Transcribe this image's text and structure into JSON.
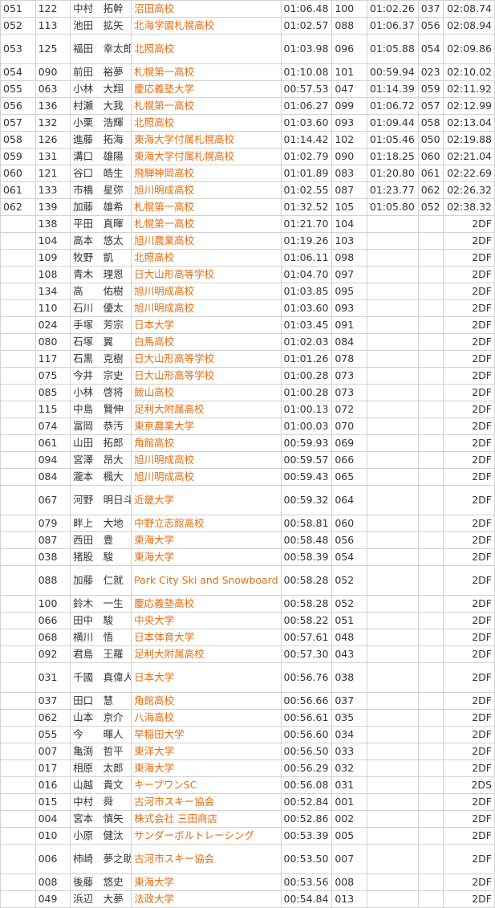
{
  "colors": {
    "team_link": "#e86d10",
    "text": "#333333",
    "border": "#d2d2d2"
  },
  "rows": [
    {
      "rank": "051",
      "bib": "122",
      "name": "中村　拓幹",
      "team": "沼田高校",
      "run1": "01:06.48",
      "rank1": "100",
      "run2": "01:02.26",
      "rank2": "037",
      "total": "02:08.74"
    },
    {
      "rank": "052",
      "bib": "113",
      "name": "池田　拡矢",
      "team": "北海学園札幌高校",
      "run1": "01:02.57",
      "rank1": "088",
      "run2": "01:06.37",
      "rank2": "056",
      "total": "02:08.94"
    },
    {
      "rank": "053",
      "bib": "125",
      "name": "福田　幸太郎",
      "team": "北照高校",
      "run1": "01:03.98",
      "rank1": "096",
      "run2": "01:05.88",
      "rank2": "054",
      "total": "02:09.86",
      "tall": true
    },
    {
      "rank": "054",
      "bib": "090",
      "name": "前田　裕夢",
      "team": "札幌第一高校",
      "run1": "01:10.08",
      "rank1": "101",
      "run2": "00:59.94",
      "rank2": "023",
      "total": "02:10.02"
    },
    {
      "rank": "055",
      "bib": "063",
      "name": "小林　大翔",
      "team": "慶応義塾大学",
      "run1": "00:57.53",
      "rank1": "047",
      "run2": "01:14.39",
      "rank2": "059",
      "total": "02:11.92"
    },
    {
      "rank": "056",
      "bib": "136",
      "name": "村瀬　大我",
      "team": "札幌第一高校",
      "run1": "01:06.27",
      "rank1": "099",
      "run2": "01:06.72",
      "rank2": "057",
      "total": "02:12.99"
    },
    {
      "rank": "057",
      "bib": "132",
      "name": "小栗　浩輝",
      "team": "北照高校",
      "run1": "01:03.60",
      "rank1": "093",
      "run2": "01:09.44",
      "rank2": "058",
      "total": "02:13.04"
    },
    {
      "rank": "058",
      "bib": "126",
      "name": "進藤　拓海",
      "team": "東海大学付属札幌高校",
      "run1": "01:14.42",
      "rank1": "102",
      "run2": "01:05.46",
      "rank2": "050",
      "total": "02:19.88"
    },
    {
      "rank": "059",
      "bib": "131",
      "name": "溝口　雄陽",
      "team": "東海大学付属札幌高校",
      "run1": "01:02.79",
      "rank1": "090",
      "run2": "01:18.25",
      "rank2": "060",
      "total": "02:21.04"
    },
    {
      "rank": "060",
      "bib": "121",
      "name": "谷口　皓生",
      "team": "飛騨神岡高校",
      "run1": "01:01.89",
      "rank1": "083",
      "run2": "01:20.80",
      "rank2": "061",
      "total": "02:22.69"
    },
    {
      "rank": "061",
      "bib": "133",
      "name": "市橋　星弥",
      "team": "旭川明成高校",
      "run1": "01:02.55",
      "rank1": "087",
      "run2": "01:23.77",
      "rank2": "062",
      "total": "02:26.32"
    },
    {
      "rank": "062",
      "bib": "139",
      "name": "加藤　雄希",
      "team": "札幌第一高校",
      "run1": "01:32.52",
      "rank1": "105",
      "run2": "01:05.80",
      "rank2": "052",
      "total": "02:38.32"
    },
    {
      "rank": "",
      "bib": "138",
      "name": "平田　真暉",
      "team": "札幌第一高校",
      "run1": "01:21.70",
      "rank1": "104",
      "run2": "",
      "rank2": "",
      "total": "2DF"
    },
    {
      "rank": "",
      "bib": "104",
      "name": "高本　悠太",
      "team": "旭川農業高校",
      "run1": "01:19.26",
      "rank1": "103",
      "run2": "",
      "rank2": "",
      "total": "2DF"
    },
    {
      "rank": "",
      "bib": "109",
      "name": "牧野　凱",
      "team": "北照高校",
      "run1": "01:06.11",
      "rank1": "098",
      "run2": "",
      "rank2": "",
      "total": "2DF"
    },
    {
      "rank": "",
      "bib": "108",
      "name": "青木　理恩",
      "team": "日大山形高等学校",
      "run1": "01:04.70",
      "rank1": "097",
      "run2": "",
      "rank2": "",
      "total": "2DF"
    },
    {
      "rank": "",
      "bib": "134",
      "name": "高　　佑樹",
      "team": "旭川明成高校",
      "run1": "01:03.85",
      "rank1": "095",
      "run2": "",
      "rank2": "",
      "total": "2DF"
    },
    {
      "rank": "",
      "bib": "110",
      "name": "石川　優太",
      "team": "旭川明成高校",
      "run1": "01:03.60",
      "rank1": "093",
      "run2": "",
      "rank2": "",
      "total": "2DF"
    },
    {
      "rank": "",
      "bib": "024",
      "name": "手塚　芳宗",
      "team": "日本大学",
      "run1": "01:03.45",
      "rank1": "091",
      "run2": "",
      "rank2": "",
      "total": "2DF"
    },
    {
      "rank": "",
      "bib": "080",
      "name": "石塚　翼",
      "team": "白馬高校",
      "run1": "01:02.03",
      "rank1": "084",
      "run2": "",
      "rank2": "",
      "total": "2DF"
    },
    {
      "rank": "",
      "bib": "117",
      "name": "石黒　克樹",
      "team": "日大山形高等学校",
      "run1": "01:01.26",
      "rank1": "078",
      "run2": "",
      "rank2": "",
      "total": "2DF"
    },
    {
      "rank": "",
      "bib": "075",
      "name": "今井　宗史",
      "team": "日大山形高等学校",
      "run1": "01:00.28",
      "rank1": "073",
      "run2": "",
      "rank2": "",
      "total": "2DF"
    },
    {
      "rank": "",
      "bib": "085",
      "name": "小林　啓将",
      "team": "飯山高校",
      "run1": "01:00.28",
      "rank1": "073",
      "run2": "",
      "rank2": "",
      "total": "2DF"
    },
    {
      "rank": "",
      "bib": "115",
      "name": "中島　賢伸",
      "team": "足利大附属高校",
      "run1": "01:00.13",
      "rank1": "072",
      "run2": "",
      "rank2": "",
      "total": "2DF"
    },
    {
      "rank": "",
      "bib": "074",
      "name": "富岡　恭汚",
      "team": "東京農業大学",
      "run1": "01:00.03",
      "rank1": "070",
      "run2": "",
      "rank2": "",
      "total": "2DF"
    },
    {
      "rank": "",
      "bib": "061",
      "name": "山田　拓郎",
      "team": "角館高校",
      "run1": "00:59.93",
      "rank1": "069",
      "run2": "",
      "rank2": "",
      "total": "2DF"
    },
    {
      "rank": "",
      "bib": "094",
      "name": "宮澤　昂大",
      "team": "旭川明成高校",
      "run1": "00:59.57",
      "rank1": "066",
      "run2": "",
      "rank2": "",
      "total": "2DF"
    },
    {
      "rank": "",
      "bib": "084",
      "name": "瀧本　楓大",
      "team": "旭川明成高校",
      "run1": "00:59.43",
      "rank1": "065",
      "run2": "",
      "rank2": "",
      "total": "2DF"
    },
    {
      "rank": "",
      "bib": "067",
      "name": "河野　明日斗",
      "team": "近畿大学",
      "run1": "00:59.32",
      "rank1": "064",
      "run2": "",
      "rank2": "",
      "total": "2DF",
      "tall": true
    },
    {
      "rank": "",
      "bib": "079",
      "name": "畔上　大地",
      "team": "中野立志館高校",
      "run1": "00:58.81",
      "rank1": "060",
      "run2": "",
      "rank2": "",
      "total": "2DF"
    },
    {
      "rank": "",
      "bib": "087",
      "name": "西田　豊",
      "team": "東海大学",
      "run1": "00:58.48",
      "rank1": "056",
      "run2": "",
      "rank2": "",
      "total": "2DF"
    },
    {
      "rank": "",
      "bib": "038",
      "name": "猪股　駿",
      "team": "東海大学",
      "run1": "00:58.39",
      "rank1": "054",
      "run2": "",
      "rank2": "",
      "total": "2DF"
    },
    {
      "rank": "",
      "bib": "088",
      "name": "加藤　仁就",
      "team": "Park City Ski and Snowboard Cl",
      "run1": "00:58.28",
      "rank1": "052",
      "run2": "",
      "rank2": "",
      "total": "2DF",
      "tall": true
    },
    {
      "rank": "",
      "bib": "100",
      "name": "鈴木　一生",
      "team": "慶応義塾高校",
      "run1": "00:58.28",
      "rank1": "052",
      "run2": "",
      "rank2": "",
      "total": "2DF"
    },
    {
      "rank": "",
      "bib": "066",
      "name": "田中　駿",
      "team": "中央大学",
      "run1": "00:58.22",
      "rank1": "051",
      "run2": "",
      "rank2": "",
      "total": "2DF"
    },
    {
      "rank": "",
      "bib": "068",
      "name": "横川　悟",
      "team": "日本体育大学",
      "run1": "00:57.61",
      "rank1": "048",
      "run2": "",
      "rank2": "",
      "total": "2DF"
    },
    {
      "rank": "",
      "bib": "092",
      "name": "君島　王羅",
      "team": "足利大附属高校",
      "run1": "00:57.30",
      "rank1": "043",
      "run2": "",
      "rank2": "",
      "total": "2DF"
    },
    {
      "rank": "",
      "bib": "031",
      "name": "千國　真偉人",
      "team": "日本大学",
      "run1": "00:56.76",
      "rank1": "038",
      "run2": "",
      "rank2": "",
      "total": "2DF",
      "tall": true
    },
    {
      "rank": "",
      "bib": "037",
      "name": "田口　慧",
      "team": "角館高校",
      "run1": "00:56.66",
      "rank1": "037",
      "run2": "",
      "rank2": "",
      "total": "2DF"
    },
    {
      "rank": "",
      "bib": "062",
      "name": "山本　京介",
      "team": "八海高校",
      "run1": "00:56.61",
      "rank1": "035",
      "run2": "",
      "rank2": "",
      "total": "2DF"
    },
    {
      "rank": "",
      "bib": "055",
      "name": "今　　暉人",
      "team": "早稲田大学",
      "run1": "00:56.60",
      "rank1": "034",
      "run2": "",
      "rank2": "",
      "total": "2DF"
    },
    {
      "rank": "",
      "bib": "007",
      "name": "亀渕　哲平",
      "team": "東洋大学",
      "run1": "00:56.50",
      "rank1": "033",
      "run2": "",
      "rank2": "",
      "total": "2DF"
    },
    {
      "rank": "",
      "bib": "017",
      "name": "相原　太郎",
      "team": "東海大学",
      "run1": "00:56.29",
      "rank1": "032",
      "run2": "",
      "rank2": "",
      "total": "2DF"
    },
    {
      "rank": "",
      "bib": "016",
      "name": "山越　貴文",
      "team": "キープワンSC",
      "run1": "00:56.08",
      "rank1": "031",
      "run2": "",
      "rank2": "",
      "total": "2DS"
    },
    {
      "rank": "",
      "bib": "015",
      "name": "中村　舜",
      "team": "古河市スキー協会",
      "run1": "00:52.84",
      "rank1": "001",
      "run2": "",
      "rank2": "",
      "total": "2DF"
    },
    {
      "rank": "",
      "bib": "004",
      "name": "宮本　慎矢",
      "team": "株式会社 三田商店",
      "run1": "00:52.86",
      "rank1": "002",
      "run2": "",
      "rank2": "",
      "total": "2DF"
    },
    {
      "rank": "",
      "bib": "010",
      "name": "小原　健汰",
      "team": "サンダーボルトレーシング",
      "run1": "00:53.39",
      "rank1": "005",
      "run2": "",
      "rank2": "",
      "total": "2DF"
    },
    {
      "rank": "",
      "bib": "006",
      "name": "柿崎　夢之助",
      "team": "古河市スキー協会",
      "run1": "00:53.50",
      "rank1": "007",
      "run2": "",
      "rank2": "",
      "total": "2DF",
      "tall": true
    },
    {
      "rank": "",
      "bib": "008",
      "name": "後藤　悠史",
      "team": "東海大学",
      "run1": "00:53.56",
      "rank1": "008",
      "run2": "",
      "rank2": "",
      "total": "2DF"
    },
    {
      "rank": "",
      "bib": "049",
      "name": "浜辺　大夢",
      "team": "法政大学",
      "run1": "00:54.84",
      "rank1": "013",
      "run2": "",
      "rank2": "",
      "total": "2DF"
    }
  ]
}
